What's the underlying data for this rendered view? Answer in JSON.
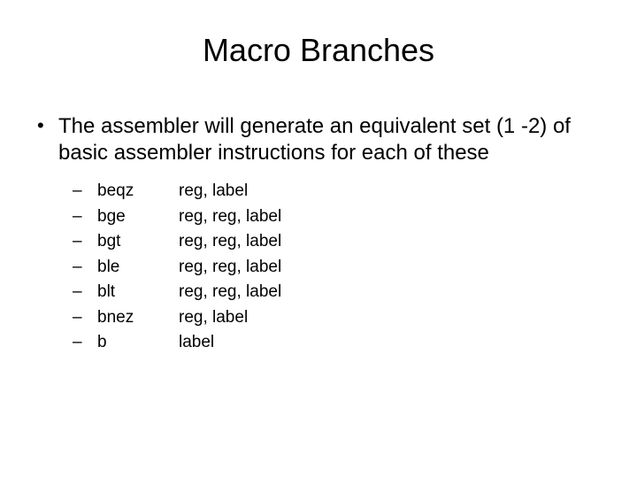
{
  "title": "Macro Branches",
  "main_bullet": "The assembler will generate an equivalent set (1 -2) of basic assembler instructions for each of these",
  "items": [
    {
      "instr": "beqz",
      "args": "reg, label"
    },
    {
      "instr": "bge",
      "args": "reg, reg, label"
    },
    {
      "instr": "bgt",
      "args": "reg, reg, label"
    },
    {
      "instr": "ble",
      "args": "reg, reg, label"
    },
    {
      "instr": "blt",
      "args": "reg, reg, label"
    },
    {
      "instr": "bnez",
      "args": "reg, label"
    },
    {
      "instr": "b",
      "args": "label"
    }
  ]
}
